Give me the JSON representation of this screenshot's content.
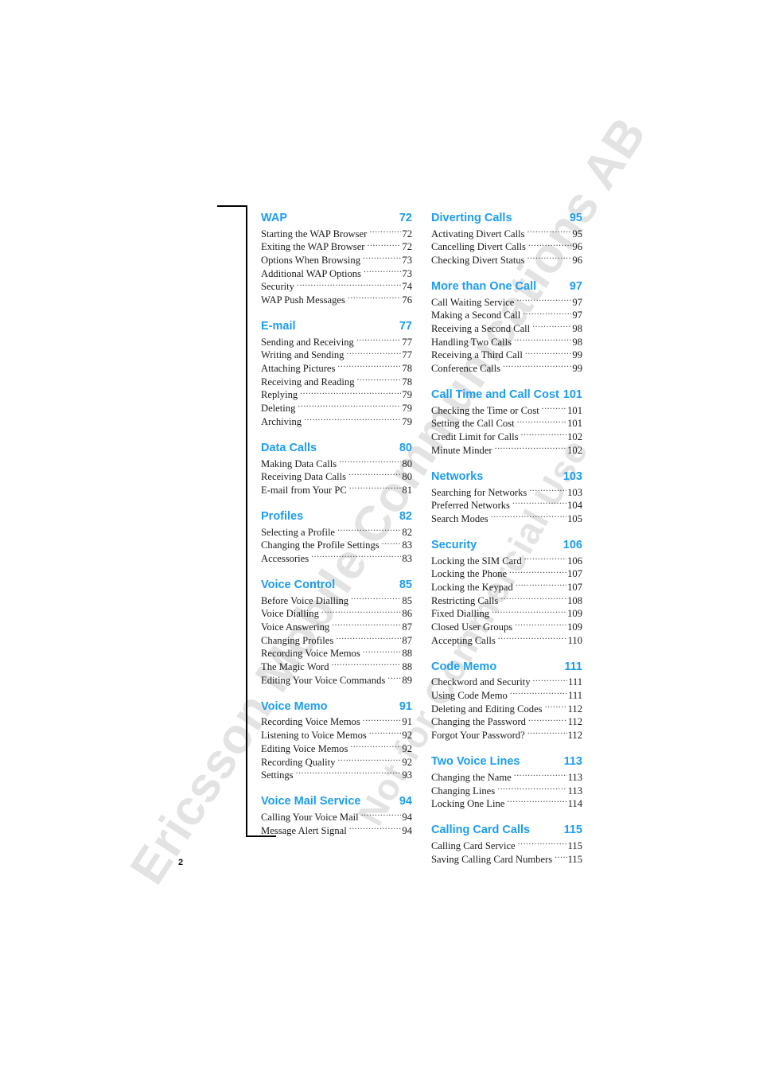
{
  "document": {
    "page_number": "2",
    "watermark_line1": "Ericsson Mobile Communications AB",
    "watermark_line2": "Not for Commercial Use",
    "accent_color": "#1b9df0",
    "text_color": "#1a1a1a"
  },
  "toc": {
    "left_column": [
      {
        "title": "WAP",
        "page": "72",
        "entries": [
          {
            "label": "Starting the WAP Browser",
            "page": "72"
          },
          {
            "label": "Exiting the WAP Browser",
            "page": "72"
          },
          {
            "label": "Options When Browsing",
            "page": "73"
          },
          {
            "label": "Additional WAP Options",
            "page": "73"
          },
          {
            "label": "Security",
            "page": "74"
          },
          {
            "label": "WAP Push Messages",
            "page": "76"
          }
        ]
      },
      {
        "title": "E-mail",
        "page": "77",
        "entries": [
          {
            "label": "Sending and Receiving",
            "page": "77"
          },
          {
            "label": "Writing and Sending",
            "page": "77"
          },
          {
            "label": "Attaching Pictures",
            "page": "78"
          },
          {
            "label": "Receiving and Reading",
            "page": "78"
          },
          {
            "label": "Replying",
            "page": "79"
          },
          {
            "label": "Deleting",
            "page": "79"
          },
          {
            "label": "Archiving",
            "page": "79"
          }
        ]
      },
      {
        "title": "Data Calls",
        "page": "80",
        "entries": [
          {
            "label": "Making Data Calls",
            "page": "80"
          },
          {
            "label": "Receiving Data Calls",
            "page": "80"
          },
          {
            "label": "E-mail from Your PC",
            "page": "81"
          }
        ]
      },
      {
        "title": "Profiles",
        "page": "82",
        "entries": [
          {
            "label": "Selecting a Profile",
            "page": "82"
          },
          {
            "label": "Changing the Profile Settings",
            "page": "83"
          },
          {
            "label": "Accessories",
            "page": "83"
          }
        ]
      },
      {
        "title": "Voice Control",
        "page": "85",
        "entries": [
          {
            "label": "Before Voice Dialling",
            "page": "85"
          },
          {
            "label": "Voice Dialling",
            "page": "86"
          },
          {
            "label": "Voice Answering",
            "page": "87"
          },
          {
            "label": "Changing Profiles",
            "page": "87"
          },
          {
            "label": "Recording Voice Memos",
            "page": "88"
          },
          {
            "label": "The Magic Word",
            "page": "88"
          },
          {
            "label": "Editing Your Voice Commands",
            "page": "89"
          }
        ]
      },
      {
        "title": "Voice Memo",
        "page": "91",
        "entries": [
          {
            "label": "Recording Voice Memos",
            "page": "91"
          },
          {
            "label": "Listening to Voice Memos",
            "page": "92"
          },
          {
            "label": "Editing Voice Memos",
            "page": "92"
          },
          {
            "label": "Recording Quality",
            "page": "92"
          },
          {
            "label": "Settings",
            "page": "93"
          }
        ]
      },
      {
        "title": "Voice Mail Service",
        "page": "94",
        "entries": [
          {
            "label": "Calling Your Voice Mail",
            "page": "94"
          },
          {
            "label": "Message Alert Signal",
            "page": "94"
          }
        ]
      }
    ],
    "right_column": [
      {
        "title": "Diverting Calls",
        "page": "95",
        "entries": [
          {
            "label": "Activating Divert Calls",
            "page": "95"
          },
          {
            "label": "Cancelling Divert Calls",
            "page": "96"
          },
          {
            "label": "Checking Divert Status",
            "page": "96"
          }
        ]
      },
      {
        "title": "More than One Call",
        "page": "97",
        "entries": [
          {
            "label": "Call Waiting Service",
            "page": "97"
          },
          {
            "label": "Making a Second Call",
            "page": "97"
          },
          {
            "label": "Receiving a Second Call",
            "page": "98"
          },
          {
            "label": "Handling Two Calls",
            "page": "98"
          },
          {
            "label": "Receiving a Third Call",
            "page": "99"
          },
          {
            "label": "Conference Calls",
            "page": "99"
          }
        ]
      },
      {
        "title": "Call Time and Call Cost",
        "page": "101",
        "entries": [
          {
            "label": "Checking the Time or Cost",
            "page": "101"
          },
          {
            "label": "Setting the Call Cost",
            "page": "101"
          },
          {
            "label": "Credit Limit for Calls",
            "page": "102"
          },
          {
            "label": "Minute Minder",
            "page": "102"
          }
        ]
      },
      {
        "title": "Networks",
        "page": "103",
        "entries": [
          {
            "label": "Searching for Networks",
            "page": "103"
          },
          {
            "label": "Preferred Networks",
            "page": "104"
          },
          {
            "label": "Search Modes",
            "page": "105"
          }
        ]
      },
      {
        "title": "Security",
        "page": "106",
        "entries": [
          {
            "label": "Locking the SIM Card",
            "page": "106"
          },
          {
            "label": "Locking the Phone",
            "page": "107"
          },
          {
            "label": "Locking the Keypad",
            "page": "107"
          },
          {
            "label": "Restricting Calls",
            "page": "108"
          },
          {
            "label": "Fixed Dialling",
            "page": "109"
          },
          {
            "label": "Closed User Groups",
            "page": "109"
          },
          {
            "label": "Accepting Calls",
            "page": "110"
          }
        ]
      },
      {
        "title": "Code Memo",
        "page": "111",
        "entries": [
          {
            "label": "Checkword and Security",
            "page": "111"
          },
          {
            "label": "Using Code Memo",
            "page": "111"
          },
          {
            "label": "Deleting and Editing Codes",
            "page": "112"
          },
          {
            "label": "Changing the Password",
            "page": "112"
          },
          {
            "label": "Forgot Your Password?",
            "page": "112"
          }
        ]
      },
      {
        "title": "Two Voice Lines",
        "page": "113",
        "entries": [
          {
            "label": "Changing the Name",
            "page": "113"
          },
          {
            "label": "Changing Lines",
            "page": "113"
          },
          {
            "label": "Locking One Line",
            "page": "114"
          }
        ]
      },
      {
        "title": "Calling Card Calls",
        "page": "115",
        "entries": [
          {
            "label": "Calling Card Service",
            "page": "115"
          },
          {
            "label": "Saving Calling Card Numbers",
            "page": "115"
          }
        ]
      }
    ]
  }
}
